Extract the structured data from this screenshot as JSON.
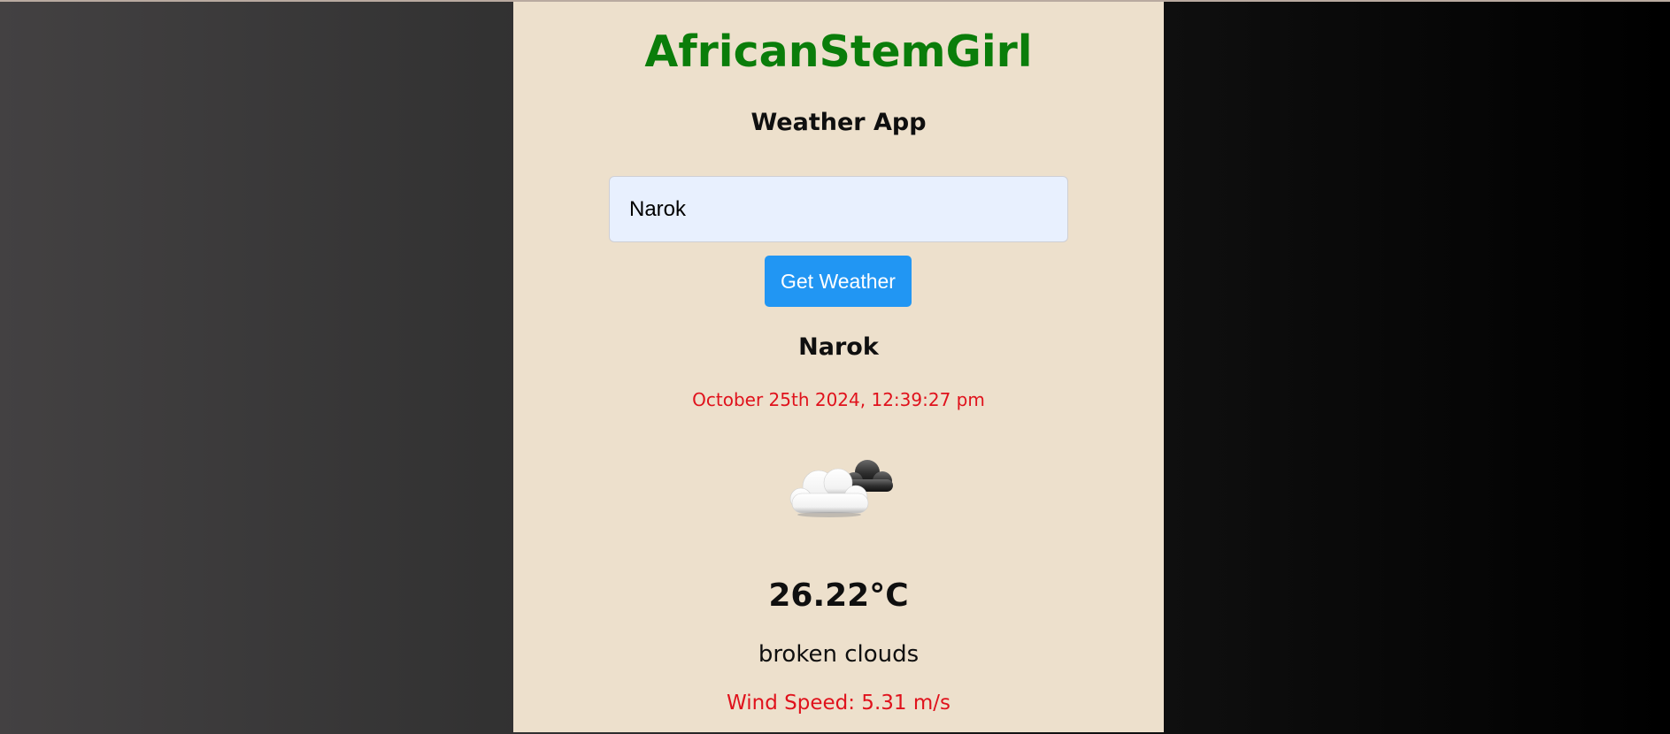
{
  "app": {
    "brand": "AfricanStemGirl",
    "subtitle": "Weather App"
  },
  "search": {
    "value": "Narok",
    "placeholder": "",
    "button_label": "Get Weather"
  },
  "weather": {
    "city": "Narok",
    "datetime": "October 25th 2024, 12:39:27 pm",
    "icon": "broken-clouds-icon",
    "temperature": "26.22°C",
    "description": "broken clouds",
    "wind_speed": "Wind Speed: 5.31 m/s"
  },
  "colors": {
    "brand": "#0a7d0a",
    "card_background": "#ede0cc",
    "button": "#2196f3",
    "accent_text": "#e0121c",
    "input_background": "#e8f0fe"
  }
}
